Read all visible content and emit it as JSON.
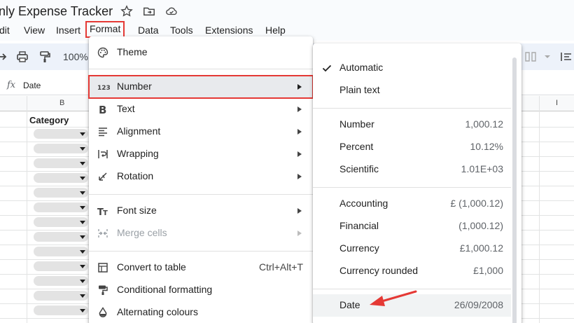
{
  "app": {
    "doc_title": "nly Expense Tracker"
  },
  "menubar": {
    "items": [
      "dit",
      "View",
      "Insert",
      "Format",
      "Data",
      "Tools",
      "Extensions",
      "Help"
    ]
  },
  "toolbar": {
    "zoom": "100%"
  },
  "formula_bar": {
    "fx": "fx",
    "value": "Date"
  },
  "grid": {
    "columns": [
      "B",
      "I"
    ],
    "category_header": "Category"
  },
  "format_menu": {
    "items": [
      {
        "label": "Theme",
        "icon": "palette-icon"
      },
      {
        "label": "Number",
        "icon": "number-format-icon",
        "submenu": true
      },
      {
        "label": "Text",
        "icon": "bold-icon",
        "submenu": true
      },
      {
        "label": "Alignment",
        "icon": "align-left-icon",
        "submenu": true
      },
      {
        "label": "Wrapping",
        "icon": "wrap-icon",
        "submenu": true
      },
      {
        "label": "Rotation",
        "icon": "rotation-icon",
        "submenu": true
      },
      {
        "label": "Font size",
        "icon": "font-size-icon",
        "submenu": true
      },
      {
        "label": "Merge cells",
        "icon": "merge-icon",
        "submenu": true,
        "disabled": true
      },
      {
        "label": "Convert to table",
        "icon": "table-icon",
        "shortcut": "Ctrl+Alt+T"
      },
      {
        "label": "Conditional formatting",
        "icon": "paint-roller-icon"
      },
      {
        "label": "Alternating colours",
        "icon": "color-drop-icon"
      }
    ]
  },
  "number_submenu": {
    "items": [
      {
        "label": "Automatic",
        "value": "",
        "checked": true
      },
      {
        "label": "Plain text",
        "value": ""
      },
      {
        "label": "Number",
        "value": "1,000.12"
      },
      {
        "label": "Percent",
        "value": "10.12%"
      },
      {
        "label": "Scientific",
        "value": "1.01E+03"
      },
      {
        "label": "Accounting",
        "value": "£ (1,000.12)"
      },
      {
        "label": "Financial",
        "value": "(1,000.12)"
      },
      {
        "label": "Currency",
        "value": "£1,000.12"
      },
      {
        "label": "Currency rounded",
        "value": "£1,000"
      },
      {
        "label": "Date",
        "value": "26/09/2008"
      }
    ]
  },
  "colors": {
    "highlight": "#e53935",
    "annotation_arrow": "#e53935"
  }
}
